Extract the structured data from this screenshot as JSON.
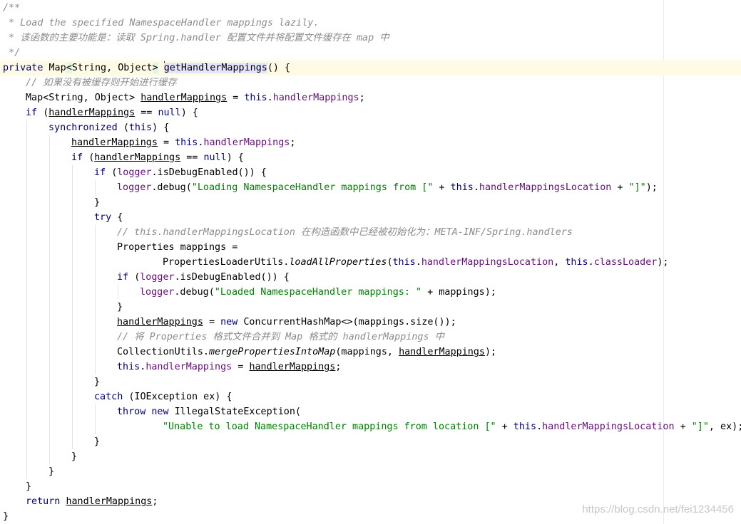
{
  "editor": {
    "watermark": "https://blog.csdn.net/fei1234456",
    "lines": [
      {
        "indent": 0,
        "tokens": [
          {
            "t": "/**",
            "c": "doc"
          }
        ]
      },
      {
        "indent": 0,
        "tokens": [
          {
            "t": " * Load the specified NamespaceHandler mappings lazily.",
            "c": "doc"
          }
        ]
      },
      {
        "indent": 0,
        "tokens": [
          {
            "t": " * 该函数的主要功能是：读取 Spring.handler 配置文件并将配置文件缓存在 map 中",
            "c": "doc"
          }
        ]
      },
      {
        "indent": 0,
        "tokens": [
          {
            "t": " */",
            "c": "doc"
          }
        ]
      },
      {
        "indent": 0,
        "current": true,
        "tokens": [
          {
            "t": "private ",
            "c": "kw"
          },
          {
            "t": "Map"
          },
          {
            "t": "<",
            "c": "match"
          },
          {
            "t": "String, Object"
          },
          {
            "t": ">",
            "c": "match"
          },
          {
            "t": " "
          },
          {
            "caret": true
          },
          {
            "t": "getHandlerMappings",
            "c": "ident"
          },
          {
            "t": "() {"
          }
        ]
      },
      {
        "indent": 1,
        "tokens": [
          {
            "t": "// 如果没有被缓存则开始进行缓存",
            "c": "cm"
          }
        ]
      },
      {
        "indent": 1,
        "tokens": [
          {
            "t": "Map<String, Object> "
          },
          {
            "t": "handlerMappings",
            "c": "u"
          },
          {
            "t": " = "
          },
          {
            "t": "this",
            "c": "kw"
          },
          {
            "t": "."
          },
          {
            "t": "handlerMappings",
            "c": "fld"
          },
          {
            "t": ";"
          }
        ]
      },
      {
        "indent": 1,
        "tokens": [
          {
            "t": "if ",
            "c": "kw"
          },
          {
            "t": "("
          },
          {
            "t": "handlerMappings",
            "c": "u"
          },
          {
            "t": " == "
          },
          {
            "t": "null",
            "c": "kw"
          },
          {
            "t": ") {"
          }
        ]
      },
      {
        "indent": 2,
        "tokens": [
          {
            "t": "synchronized ",
            "c": "kw"
          },
          {
            "t": "("
          },
          {
            "t": "this",
            "c": "kw"
          },
          {
            "t": ") {"
          }
        ]
      },
      {
        "indent": 3,
        "tokens": [
          {
            "t": "handlerMappings",
            "c": "u"
          },
          {
            "t": " = "
          },
          {
            "t": "this",
            "c": "kw"
          },
          {
            "t": "."
          },
          {
            "t": "handlerMappings",
            "c": "fld"
          },
          {
            "t": ";"
          }
        ]
      },
      {
        "indent": 3,
        "tokens": [
          {
            "t": "if ",
            "c": "kw"
          },
          {
            "t": "("
          },
          {
            "t": "handlerMappings",
            "c": "u"
          },
          {
            "t": " == "
          },
          {
            "t": "null",
            "c": "kw"
          },
          {
            "t": ") {"
          }
        ]
      },
      {
        "indent": 4,
        "tokens": [
          {
            "t": "if ",
            "c": "kw"
          },
          {
            "t": "("
          },
          {
            "t": "logger",
            "c": "fld"
          },
          {
            "t": ".isDebugEnabled()) {"
          }
        ]
      },
      {
        "indent": 5,
        "tokens": [
          {
            "t": "logger",
            "c": "fld"
          },
          {
            "t": ".debug("
          },
          {
            "t": "\"Loading NamespaceHandler mappings from [\"",
            "c": "str"
          },
          {
            "t": " + "
          },
          {
            "t": "this",
            "c": "kw"
          },
          {
            "t": "."
          },
          {
            "t": "handlerMappingsLocation",
            "c": "fld"
          },
          {
            "t": " + "
          },
          {
            "t": "\"]\"",
            "c": "str"
          },
          {
            "t": ");"
          }
        ]
      },
      {
        "indent": 4,
        "tokens": [
          {
            "t": "}"
          }
        ]
      },
      {
        "indent": 4,
        "tokens": [
          {
            "t": "try ",
            "c": "kw"
          },
          {
            "t": "{"
          }
        ]
      },
      {
        "indent": 5,
        "tokens": [
          {
            "t": "// this.handlerMappingsLocation 在构造函数中已经被初始化为：META-INF/Spring.handlers",
            "c": "cm"
          }
        ]
      },
      {
        "indent": 5,
        "tokens": [
          {
            "t": "Properties mappings ="
          }
        ]
      },
      {
        "indent": 5,
        "extra": 2,
        "tokens": [
          {
            "t": "PropertiesLoaderUtils."
          },
          {
            "t": "loadAllProperties",
            "c": "it"
          },
          {
            "t": "("
          },
          {
            "t": "this",
            "c": "kw"
          },
          {
            "t": "."
          },
          {
            "t": "handlerMappingsLocation",
            "c": "fld"
          },
          {
            "t": ", "
          },
          {
            "t": "this",
            "c": "kw"
          },
          {
            "t": "."
          },
          {
            "t": "classLoader",
            "c": "fld"
          },
          {
            "t": ");"
          }
        ]
      },
      {
        "indent": 5,
        "tokens": [
          {
            "t": "if ",
            "c": "kw"
          },
          {
            "t": "("
          },
          {
            "t": "logger",
            "c": "fld"
          },
          {
            "t": ".isDebugEnabled()) {"
          }
        ]
      },
      {
        "indent": 6,
        "tokens": [
          {
            "t": "logger",
            "c": "fld"
          },
          {
            "t": ".debug("
          },
          {
            "t": "\"Loaded NamespaceHandler mappings: \"",
            "c": "str"
          },
          {
            "t": " + mappings);"
          }
        ]
      },
      {
        "indent": 5,
        "tokens": [
          {
            "t": "}"
          }
        ]
      },
      {
        "indent": 5,
        "tokens": [
          {
            "t": "handlerMappings",
            "c": "u"
          },
          {
            "t": " = "
          },
          {
            "t": "new ",
            "c": "kw"
          },
          {
            "t": "ConcurrentHashMap<>(mappings.size());"
          }
        ]
      },
      {
        "indent": 5,
        "tokens": [
          {
            "t": "// 将 Properties 格式文件合并到 Map 格式的 handlerMappings 中",
            "c": "cm"
          }
        ]
      },
      {
        "indent": 5,
        "tokens": [
          {
            "t": "CollectionUtils."
          },
          {
            "t": "mergePropertiesIntoMap",
            "c": "it"
          },
          {
            "t": "(mappings, "
          },
          {
            "t": "handlerMappings",
            "c": "u"
          },
          {
            "t": ");"
          }
        ]
      },
      {
        "indent": 5,
        "tokens": [
          {
            "t": "this",
            "c": "kw"
          },
          {
            "t": "."
          },
          {
            "t": "handlerMappings",
            "c": "fld"
          },
          {
            "t": " = "
          },
          {
            "t": "handlerMappings",
            "c": "u"
          },
          {
            "t": ";"
          }
        ]
      },
      {
        "indent": 4,
        "tokens": [
          {
            "t": "}"
          }
        ]
      },
      {
        "indent": 4,
        "tokens": [
          {
            "t": "catch ",
            "c": "kw"
          },
          {
            "t": "(IOException ex) {"
          }
        ]
      },
      {
        "indent": 5,
        "tokens": [
          {
            "t": "throw new ",
            "c": "kw"
          },
          {
            "t": "IllegalStateException("
          }
        ]
      },
      {
        "indent": 5,
        "extra": 2,
        "tokens": [
          {
            "t": "\"Unable to load NamespaceHandler mappings from location [\"",
            "c": "str"
          },
          {
            "t": " + "
          },
          {
            "t": "this",
            "c": "kw"
          },
          {
            "t": "."
          },
          {
            "t": "handlerMappingsLocation",
            "c": "fld"
          },
          {
            "t": " + "
          },
          {
            "t": "\"]\"",
            "c": "str"
          },
          {
            "t": ", ex);"
          }
        ]
      },
      {
        "indent": 4,
        "tokens": [
          {
            "t": "}"
          }
        ]
      },
      {
        "indent": 3,
        "tokens": [
          {
            "t": "}"
          }
        ]
      },
      {
        "indent": 2,
        "tokens": [
          {
            "t": "}"
          }
        ]
      },
      {
        "indent": 1,
        "tokens": [
          {
            "t": "}"
          }
        ]
      },
      {
        "indent": 1,
        "tokens": [
          {
            "t": "return ",
            "c": "kw"
          },
          {
            "t": "handlerMappings",
            "c": "u"
          },
          {
            "t": ";"
          }
        ]
      },
      {
        "indent": 0,
        "tokens": [
          {
            "t": "}"
          }
        ]
      }
    ]
  }
}
